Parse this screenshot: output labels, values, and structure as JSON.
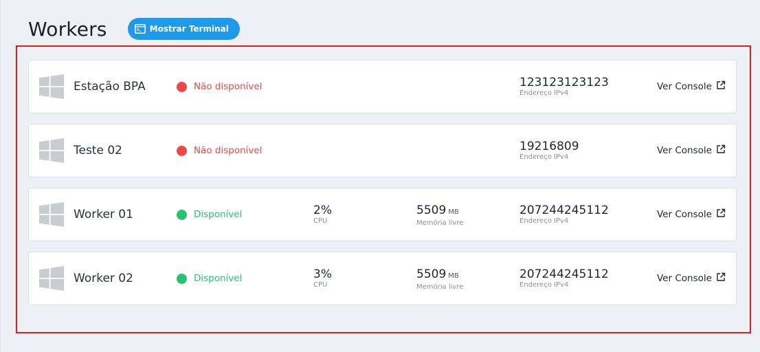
{
  "header": {
    "title": "Workers",
    "terminal_button": "Mostrar Terminal"
  },
  "colors": {
    "accent": "#1e9be8",
    "unavailable": "#f04848",
    "available": "#25c46c",
    "highlight": "#e01b1b"
  },
  "workers": [
    {
      "name": "Estação BPA",
      "os_icon": "windows-icon",
      "status": "Não disponível",
      "status_type": "unavailable",
      "cpu": null,
      "memory": null,
      "ip": "123123123123",
      "ip_label": "Endereço IPv4",
      "console_label": "Ver Console"
    },
    {
      "name": "Teste 02",
      "os_icon": "windows-icon",
      "status": "Não disponível",
      "status_type": "unavailable",
      "cpu": null,
      "memory": null,
      "ip": "19216809",
      "ip_label": "Endereço IPv4",
      "console_label": "Ver Console"
    },
    {
      "name": "Worker 01",
      "os_icon": "windows-icon",
      "status": "Disponível",
      "status_type": "available",
      "cpu": {
        "value": "2%",
        "label": "CPU"
      },
      "memory": {
        "value": "5509",
        "unit": "MB",
        "label": "Memória livre"
      },
      "ip": "207244245112",
      "ip_label": "Endereço IPv4",
      "console_label": "Ver Console"
    },
    {
      "name": "Worker 02",
      "os_icon": "windows-icon",
      "status": "Disponível",
      "status_type": "available",
      "cpu": {
        "value": "3%",
        "label": "CPU"
      },
      "memory": {
        "value": "5509",
        "unit": "MB",
        "label": "Memória livre"
      },
      "ip": "207244245112",
      "ip_label": "Endereço IPv4",
      "console_label": "Ver Console"
    }
  ]
}
